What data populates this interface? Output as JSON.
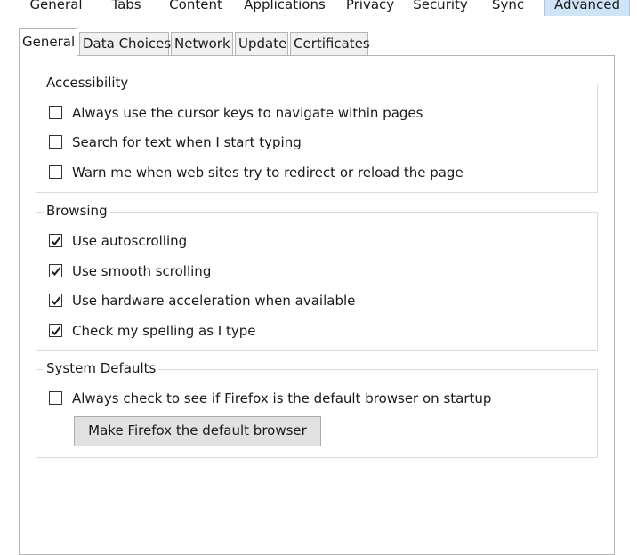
{
  "top_tabs": [
    "General",
    "Tabs",
    "Content",
    "Applications",
    "Privacy",
    "Security",
    "Sync",
    "Advanced"
  ],
  "sub_tabs": [
    "General",
    "Data Choices",
    "Network",
    "Update",
    "Certificates"
  ],
  "accessibility": {
    "title": "Accessibility",
    "options": [
      {
        "label": "Always use the cursor keys to navigate within pages",
        "checked": false
      },
      {
        "label": "Search for text when I start typing",
        "checked": false
      },
      {
        "label": "Warn me when web sites try to redirect or reload the page",
        "checked": false
      }
    ]
  },
  "browsing": {
    "title": "Browsing",
    "options": [
      {
        "label": "Use autoscrolling",
        "checked": true
      },
      {
        "label": "Use smooth scrolling",
        "checked": true
      },
      {
        "label": "Use hardware acceleration when available",
        "checked": true
      },
      {
        "label": "Check my spelling as I type",
        "checked": true
      }
    ]
  },
  "system_defaults": {
    "title": "System Defaults",
    "options": [
      {
        "label": "Always check to see if Firefox is the default browser on startup",
        "checked": false
      }
    ],
    "button_label": "Make Firefox the default browser"
  },
  "colors": {
    "selected_top_tab": "#cfe4f6",
    "border": "#b5b5b5",
    "button_bg": "#e1e1e1"
  }
}
